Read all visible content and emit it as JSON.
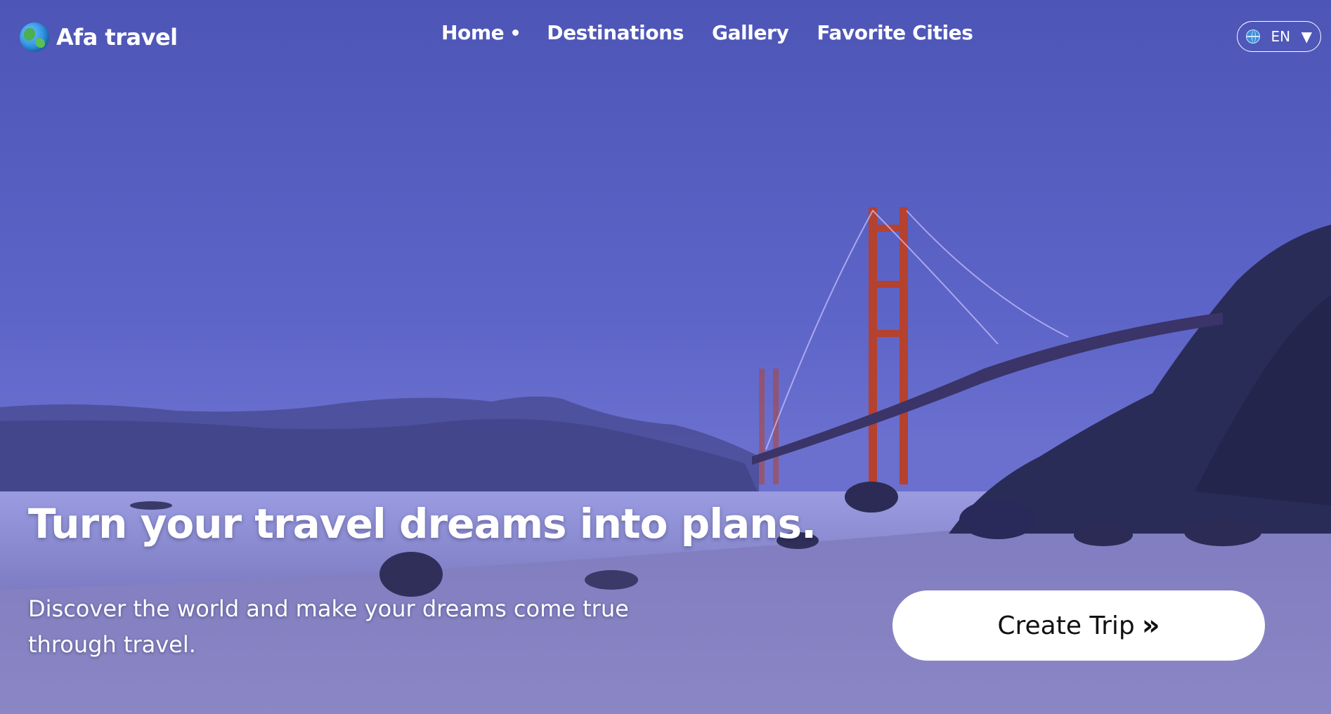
{
  "brand": {
    "name": "Afa travel",
    "logo_icon": "globe-icon"
  },
  "nav": {
    "items": [
      {
        "label": "Home",
        "active": true
      },
      {
        "label": "Destinations"
      },
      {
        "label": "Gallery"
      },
      {
        "label": "Favorite Cities"
      }
    ]
  },
  "language": {
    "value": "EN",
    "icon": "globe-icon",
    "caret": "▼"
  },
  "hero": {
    "headline": "Turn your travel dreams into plans.",
    "subtext": "Discover the world and make your dreams come true through travel.",
    "cta_label": "Create Trip",
    "cta_chevron": "»",
    "background_image": "golden-gate-bridge-dusk-beach"
  },
  "colors": {
    "sky": "#5b63c6",
    "bridge": "#c0392b",
    "cta_bg": "#ffffff",
    "text": "#ffffff"
  }
}
